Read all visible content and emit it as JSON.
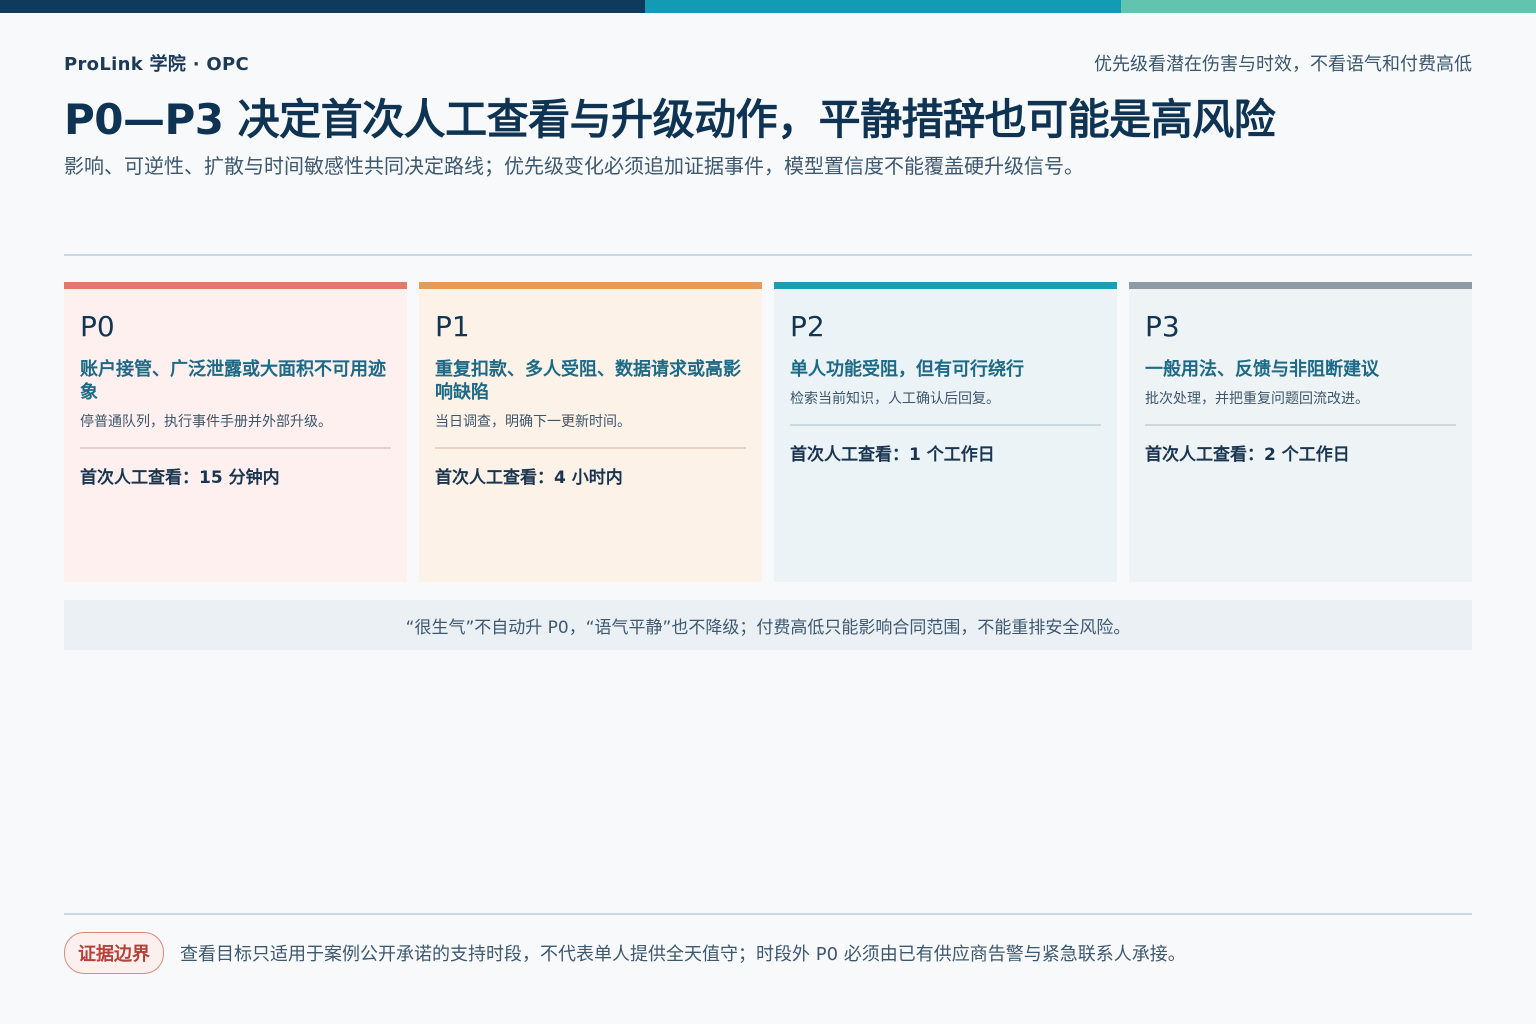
{
  "header": {
    "brand": "ProLink 学院 · OPC",
    "tagline": "优先级看潜在伤害与时效，不看语气和付费高低",
    "title": "P0—P3 决定首次人工查看与升级动作，平静措辞也可能是高风险",
    "subtitle": "影响、可逆性、扩散与时间敏感性共同决定路线；优先级变化必须追加证据事件，模型置信度不能覆盖硬升级信号。"
  },
  "cards": [
    {
      "level": "P0",
      "headline": "账户接管、广泛泄露或大面积不可用迹象",
      "desc": "停普通队列，执行事件手册并外部升级。",
      "sla": "首次人工查看：15 分钟内",
      "accent": "#e27a6c",
      "background": "#fdf0ee",
      "divider": "#e8cfcc"
    },
    {
      "level": "P1",
      "headline": "重复扣款、多人受阻、数据请求或高影响缺陷",
      "desc": "当日调查，明确下一更新时间。",
      "sla": "首次人工查看：4 小时内",
      "accent": "#e59a58",
      "background": "#fdf2e8",
      "divider": "#e7d4c3"
    },
    {
      "level": "P2",
      "headline": "单人功能受阻，但有可行绕行",
      "desc": "检索当前知识，人工确认后回复。",
      "sla": "首次人工查看：1 个工作日",
      "accent": "#1c9db6",
      "background": "#ebf3f6",
      "divider": "#c9d9e1"
    },
    {
      "level": "P3",
      "headline": "一般用法、反馈与非阻断建议",
      "desc": "批次处理，并把重复问题回流改进。",
      "sla": "首次人工查看：2 个工作日",
      "accent": "#8d9ca4",
      "background": "#eef3f5",
      "divider": "#cdd8de"
    }
  ],
  "note": "“很生气”不自动升 P0，“语气平静”也不降级；付费高低只能影响合同范围，不能重排安全风险。",
  "footer": {
    "badge": "证据边界",
    "text": "查看目标只适用于案例公开承诺的支持时段，不代表单人提供全天值守；时段外 P0 必须由已有供应商告警与紧急联系人承接。"
  }
}
